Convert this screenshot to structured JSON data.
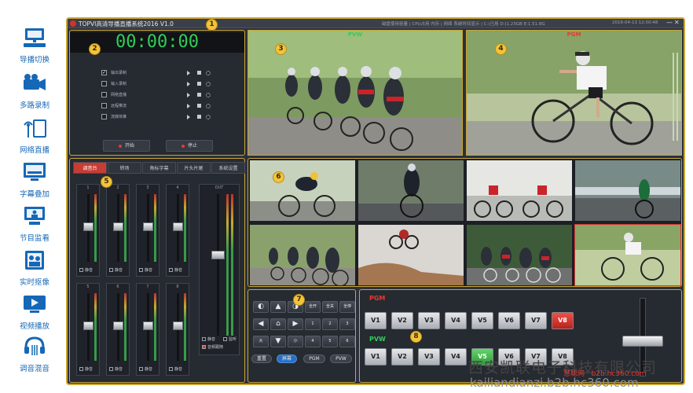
{
  "sidebar": {
    "items": [
      {
        "label": "导播切换",
        "icon": "monitor-keyboard-icon"
      },
      {
        "label": "多路录制",
        "icon": "video-camera-icon"
      },
      {
        "label": "网络直播",
        "icon": "broadcast-antenna-icon"
      },
      {
        "label": "字幕叠加",
        "icon": "subtitle-screen-icon"
      },
      {
        "label": "节目监看",
        "icon": "monitor-person-icon"
      },
      {
        "label": "实时抠像",
        "icon": "chroma-key-icon"
      },
      {
        "label": "视频播放",
        "icon": "video-player-icon"
      },
      {
        "label": "调音混音",
        "icon": "headset-mixer-icon"
      }
    ]
  },
  "titlebar": {
    "title": "TOPVI高清导播直播系统2016 V1.0",
    "status": "磁盘使用容量 | CPU占用 内存 | 网络 系统时间显示 | C:(已用 D:)1.23GB E:1.51.8G",
    "datetime": "2016-04-13 12:00:48",
    "minimize": "—",
    "close": "✕"
  },
  "recorder": {
    "clock": "00:00:00",
    "rows": [
      {
        "label": "输出录制",
        "checked": true
      },
      {
        "label": "输入录制",
        "checked": false
      },
      {
        "label": "网络直播",
        "checked": false
      },
      {
        "label": "远程推流",
        "checked": false
      },
      {
        "label": "流媒体推",
        "checked": false
      }
    ],
    "record_button": "开始",
    "stop_button": "停止"
  },
  "monitors": {
    "pvw_label": "PVW",
    "pgm_label": "PGM"
  },
  "mixer": {
    "tabs": [
      "调音台",
      "转场",
      "角标字幕",
      "片头片尾",
      "系统设置"
    ],
    "active_tab": "调音台",
    "channels_top": [
      "1",
      "2",
      "3",
      "4"
    ],
    "channels_bottom": [
      "5",
      "6",
      "7",
      "8"
    ],
    "mute_label": "静音",
    "master_label": "OUT",
    "master_options": [
      "静音",
      "监听",
      "音频跟随"
    ]
  },
  "keypad": {
    "row1": [
      "◐",
      "▲",
      "◑",
      "全开",
      "全关",
      "全停"
    ],
    "row2": [
      "◀",
      "⌂",
      "▶",
      "1",
      "2",
      "3"
    ],
    "row3": [
      "大",
      "▼",
      "小",
      "4",
      "5",
      "6"
    ],
    "pills": [
      "重置",
      "屏幕",
      "PGM",
      "PVW"
    ]
  },
  "switcher": {
    "pgm_label": "PGM",
    "pvw_label": "PVW",
    "pgm_buttons": [
      "V1",
      "V2",
      "V3",
      "V4",
      "V5",
      "V6",
      "V7",
      "V8"
    ],
    "pvw_buttons": [
      "V1",
      "V2",
      "V3",
      "V4",
      "V5",
      "V6",
      "V7",
      "V8"
    ],
    "pgm_active": "V8",
    "pvw_active": "V5"
  },
  "callouts": [
    "1",
    "2",
    "3",
    "4",
    "5",
    "6",
    "7",
    "8"
  ],
  "watermark": {
    "company": "西安凯联电子科技有限公司",
    "url": "kailiandianzi.b2b.hc360.com",
    "stamp": "慧聪网 · b2b.hc360.com"
  },
  "colors": {
    "frame_border": "#c9a634",
    "pgm_red": "#d9352e",
    "pvw_green": "#2fce58",
    "sidebar_text": "#1668b6"
  }
}
